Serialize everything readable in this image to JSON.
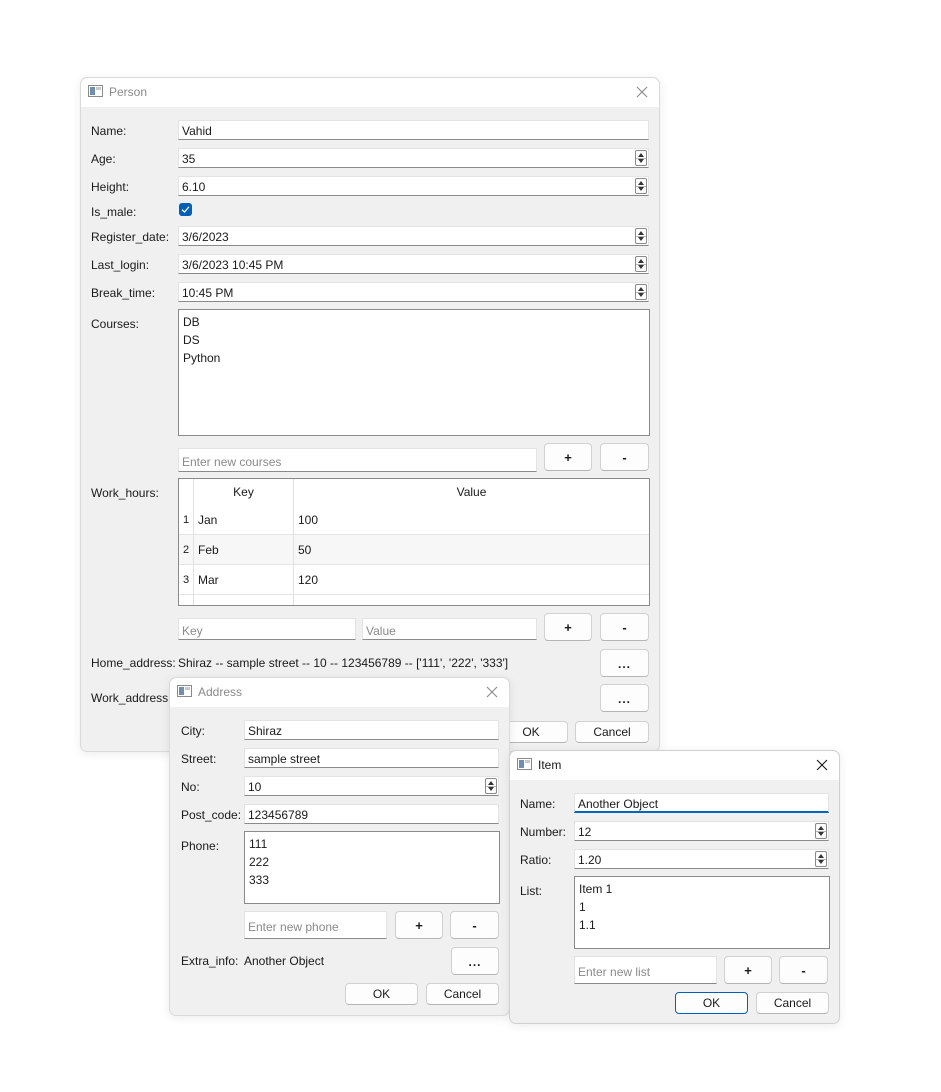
{
  "person": {
    "title": "Person",
    "labels": {
      "name": "Name:",
      "age": "Age:",
      "height": "Height:",
      "is_male": "Is_male:",
      "register_date": "Register_date:",
      "last_login": "Last_login:",
      "break_time": "Break_time:",
      "courses": "Courses:",
      "work_hours": "Work_hours:",
      "home_address": "Home_address:",
      "work_address": "Work_address:"
    },
    "values": {
      "name": "Vahid",
      "age": "35",
      "height": "6.10",
      "is_male": true,
      "register_date": "3/6/2023",
      "last_login": "3/6/2023 10:45 PM",
      "break_time": "10:45 PM",
      "home_address": "Shiraz -- sample street -- 10 -- 123456789 -- ['111', '222', '333']"
    },
    "courses": [
      "DB",
      "DS",
      "Python"
    ],
    "new_course_placeholder": "Enter new courses",
    "work_hours": {
      "headers": [
        "Key",
        "Value"
      ],
      "rows": [
        {
          "num": "1",
          "key": "Jan",
          "value": "100"
        },
        {
          "num": "2",
          "key": "Feb",
          "value": "50"
        },
        {
          "num": "3",
          "key": "Mar",
          "value": "120"
        }
      ],
      "key_placeholder": "Key",
      "value_placeholder": "Value"
    },
    "buttons": {
      "add": "+",
      "remove": "-",
      "browse": "...",
      "ok": "OK",
      "cancel": "Cancel"
    }
  },
  "address": {
    "title": "Address",
    "labels": {
      "city": "City:",
      "street": "Street:",
      "no": "No:",
      "post_code": "Post_code:",
      "phone": "Phone:",
      "extra_info": "Extra_info:"
    },
    "values": {
      "city": "Shiraz",
      "street": "sample street",
      "no": "10",
      "post_code": "123456789",
      "extra_info": "Another Object"
    },
    "phones": [
      "111",
      "222",
      "333"
    ],
    "new_phone_placeholder": "Enter new phone",
    "buttons": {
      "add": "+",
      "remove": "-",
      "browse": "...",
      "ok": "OK",
      "cancel": "Cancel"
    }
  },
  "item": {
    "title": "Item",
    "labels": {
      "name": "Name:",
      "number": "Number:",
      "ratio": "Ratio:",
      "list": "List:"
    },
    "values": {
      "name": "Another Object",
      "number": "12",
      "ratio": "1.20"
    },
    "list": [
      "Item 1",
      "1",
      "1.1"
    ],
    "new_list_placeholder": "Enter new list",
    "buttons": {
      "add": "+",
      "remove": "-",
      "ok": "OK",
      "cancel": "Cancel"
    }
  },
  "colors": {
    "accent": "#005fb8",
    "window_bg": "#f0f0f0",
    "field_bg": "#ffffff"
  },
  "icons": [
    "app-window-icon",
    "close-icon",
    "check-icon",
    "spin-up-icon",
    "spin-down-icon"
  ]
}
